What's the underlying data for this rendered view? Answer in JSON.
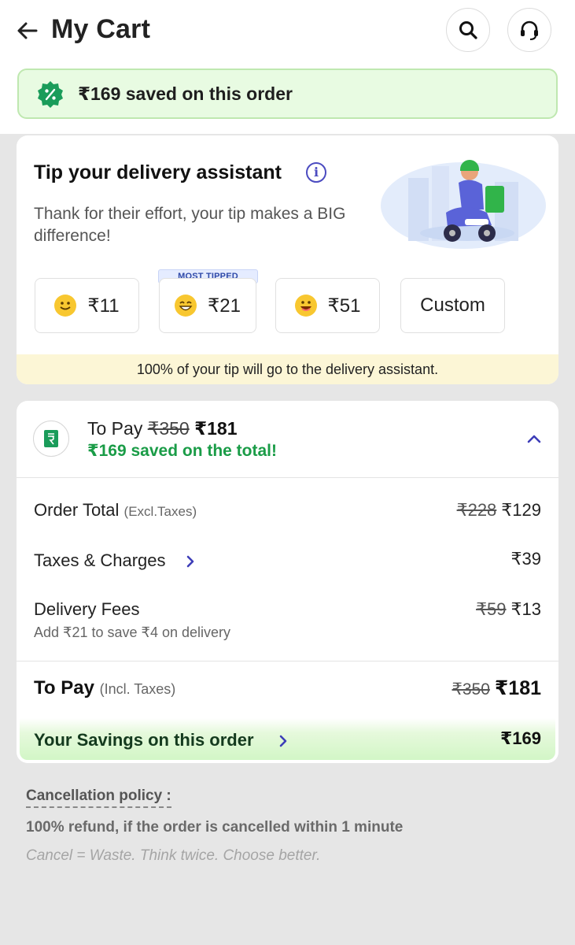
{
  "header": {
    "title": "My Cart",
    "back_icon": "arrow-left-icon",
    "search_icon": "search-icon",
    "support_icon": "headset-icon"
  },
  "savings_banner": {
    "text": "₹169 saved on this order",
    "icon": "discount-badge-icon",
    "accent": "#1a9c5a"
  },
  "tip": {
    "title": "Tip your delivery assistant",
    "subtitle": "Thank for their effort, your tip makes a BIG difference!",
    "most_tipped_tag": "MOST TIPPED",
    "options": [
      {
        "emoji": "slight-smile-emoji",
        "amount": "₹11"
      },
      {
        "emoji": "grin-emoji",
        "amount": "₹21"
      },
      {
        "emoji": "big-smile-emoji",
        "amount": "₹51"
      },
      {
        "label": "Custom"
      }
    ],
    "note": "100% of your tip will go to the delivery assistant."
  },
  "bill": {
    "to_pay_label": "To Pay",
    "to_pay_original": "₹350",
    "to_pay_final": "₹181",
    "saved_text": "₹169 saved on the total!",
    "order_total": {
      "label": "Order Total",
      "sub": "(Excl.Taxes)",
      "original": "₹228",
      "final": "₹129"
    },
    "taxes": {
      "label": "Taxes & Charges",
      "value": "₹39"
    },
    "delivery": {
      "label": "Delivery Fees",
      "original": "₹59",
      "final": "₹13",
      "hint": "Add ₹21 to save ₹4 on delivery"
    },
    "total": {
      "label": "To Pay",
      "sub": "(Incl. Taxes)",
      "original": "₹350",
      "final": "₹181"
    },
    "savings": {
      "label": "Your Savings on this order",
      "value": "₹169"
    }
  },
  "policy": {
    "title": "Cancellation policy :",
    "text": "100% refund, if the order is cancelled within 1 minute",
    "quote": "Cancel = Waste. Think twice. Choose better."
  }
}
